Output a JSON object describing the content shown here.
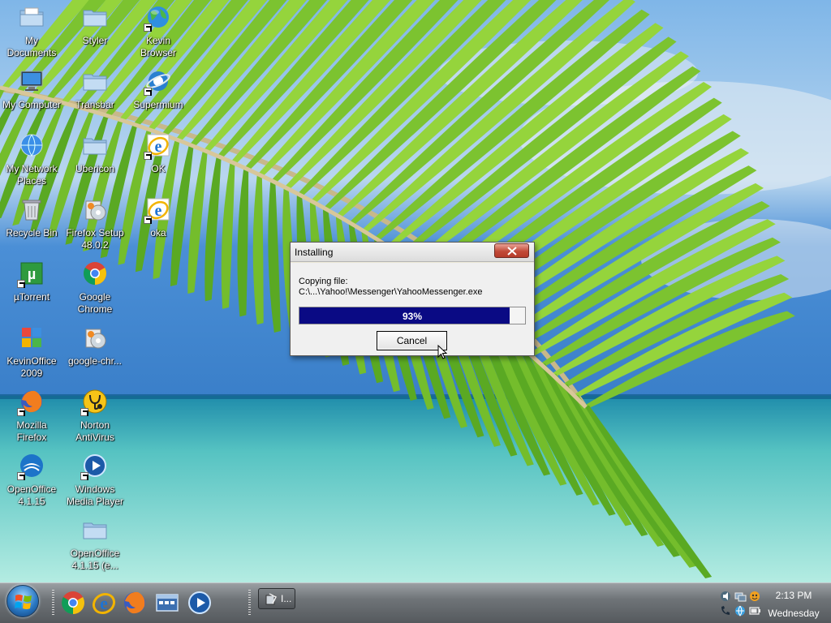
{
  "desktop": {
    "icons": [
      {
        "label": "My\nDocuments",
        "icon": "folder-documents-icon"
      },
      {
        "label": "Styler",
        "icon": "folder-icon"
      },
      {
        "label": "Kevin\nBrowser",
        "icon": "globe-icon"
      },
      {
        "label": "My Computer",
        "icon": "computer-icon"
      },
      {
        "label": "Transbar",
        "icon": "folder-icon"
      },
      {
        "label": "Supermium",
        "icon": "browser-icon"
      },
      {
        "label": "My Network\nPlaces",
        "icon": "network-globe-icon"
      },
      {
        "label": "Ubericon",
        "icon": "folder-icon"
      },
      {
        "label": "OK",
        "icon": "internet-explorer-icon"
      },
      {
        "label": "Recycle Bin",
        "icon": "recycle-bin-icon"
      },
      {
        "label": "Firefox Setup\n48.0.2",
        "icon": "installer-icon"
      },
      {
        "label": "oka",
        "icon": "internet-explorer-icon"
      },
      {
        "label": "µTorrent",
        "icon": "utorrent-icon"
      },
      {
        "label": "Google\nChrome",
        "icon": "chrome-icon"
      },
      {
        "label": "KevinOffice\n2009",
        "icon": "office-icon"
      },
      {
        "label": "google-chr...",
        "icon": "installer-icon"
      },
      {
        "label": "Mozilla\nFirefox",
        "icon": "firefox-icon"
      },
      {
        "label": "Norton\nAntiVirus",
        "icon": "norton-icon"
      },
      {
        "label": "OpenOffice\n4.1.15",
        "icon": "openoffice-icon"
      },
      {
        "label": "Windows\nMedia Player",
        "icon": "media-player-icon"
      },
      {
        "label": "OpenOffice\n4.1.15 (e...",
        "icon": "folder-icon"
      }
    ]
  },
  "dialog": {
    "title": "Installing",
    "message_line1": "Copying file:",
    "message_line2": "C:\\...\\Yahoo!\\Messenger\\YahooMessenger.exe",
    "progress_text": "93%",
    "progress": 0.93,
    "cancel_label": "Cancel"
  },
  "taskbar": {
    "task_label": "I...",
    "clock_time": "2:13 PM",
    "clock_day": "Wednesday",
    "quick_launch": [
      "chrome-icon",
      "internet-explorer-icon",
      "firefox-icon",
      "show-desktop-icon",
      "media-player-icon"
    ]
  },
  "colors": {
    "progress_fill": "#0a0a84",
    "close_button": "#c24a38"
  }
}
